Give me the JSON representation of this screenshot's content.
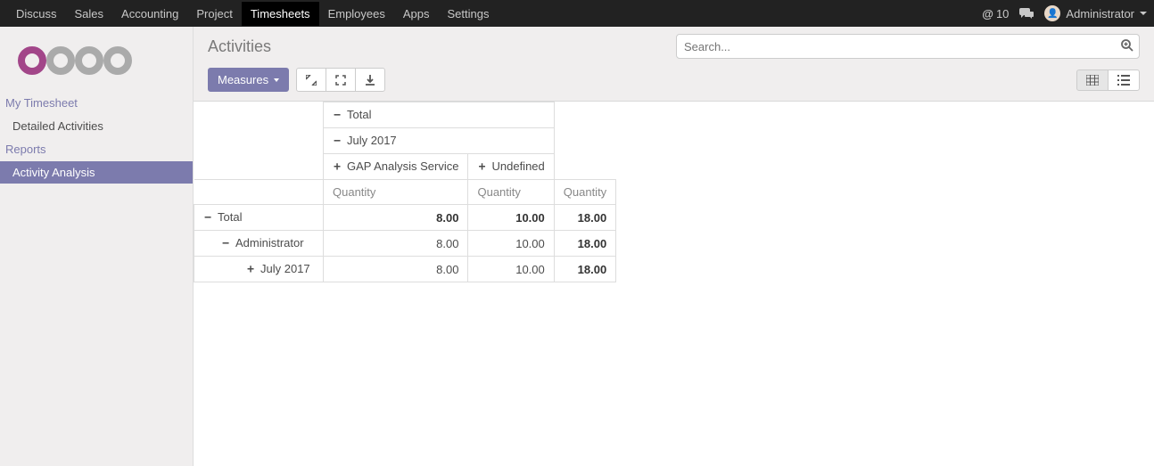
{
  "nav": {
    "items": [
      "Discuss",
      "Sales",
      "Accounting",
      "Project",
      "Timesheets",
      "Employees",
      "Apps",
      "Settings"
    ],
    "active_index": 4,
    "notif_count": "10",
    "user_name": "Administrator"
  },
  "sidebar": {
    "section1_title": "My Timesheet",
    "section1_items": [
      "Detailed Activities"
    ],
    "section2_title": "Reports",
    "section2_items": [
      "Activity Analysis"
    ],
    "active_item": "Activity Analysis"
  },
  "header": {
    "breadcrumb": "Activities",
    "search_placeholder": "Search...",
    "measures_label": "Measures"
  },
  "pivot": {
    "col_headers": {
      "total": "Total",
      "month": "July 2017",
      "sub1": "GAP Analysis Service",
      "sub2": "Undefined",
      "measure": "Quantity"
    },
    "rows": [
      {
        "label": "Total",
        "indent": 0,
        "toggle": "−",
        "v1": "8.00",
        "v2": "10.00",
        "v3": "18.00",
        "bold_row": true
      },
      {
        "label": "Administrator",
        "indent": 1,
        "toggle": "−",
        "v1": "8.00",
        "v2": "10.00",
        "v3": "18.00",
        "bold_row": false
      },
      {
        "label": "July 2017",
        "indent": 2,
        "toggle": "+",
        "v1": "8.00",
        "v2": "10.00",
        "v3": "18.00",
        "bold_row": false
      }
    ]
  }
}
